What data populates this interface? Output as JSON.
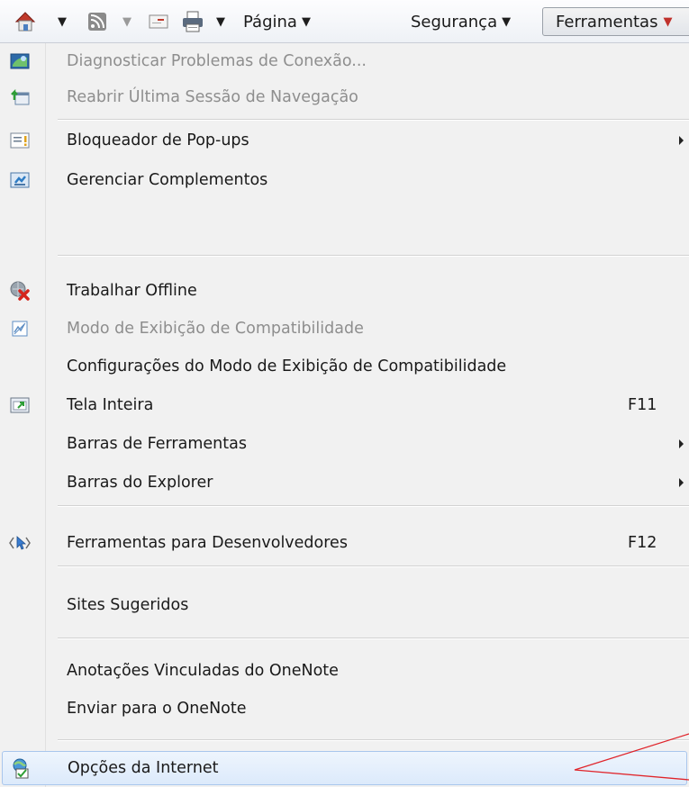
{
  "toolbar": {
    "items": [
      "home-icon",
      "feeds-icon",
      "mail-icon",
      "print-icon"
    ],
    "page_label": "Página",
    "security_label": "Segurança",
    "tools_label": "Ferramentas"
  },
  "menu": {
    "diagnose": "Diagnosticar Problemas de Conexão...",
    "reopen": "Reabrir Última Sessão de Navegação",
    "popup_blocker": "Bloqueador de Pop-ups",
    "manage_addons": "Gerenciar Complementos",
    "work_offline": "Trabalhar Offline",
    "compat_view": "Modo de Exibição de Compatibilidade",
    "compat_settings": "Configurações do Modo de Exibição de Compatibilidade",
    "fullscreen": "Tela Inteira",
    "fullscreen_key": "F11",
    "toolbars": "Barras de Ferramentas",
    "explorer_bars": "Barras do Explorer",
    "dev_tools": "Ferramentas para Desenvolvedores",
    "dev_tools_key": "F12",
    "suggested_sites": "Sites Sugeridos",
    "onenote_linked": "Anotações Vinculadas do OneNote",
    "send_onenote": "Enviar para o OneNote",
    "internet_options": "Opções da Internet"
  },
  "colors": {
    "accent": "#a9c6ec",
    "callout": "#e0242a",
    "disabled_text": "#8e8e8e"
  }
}
